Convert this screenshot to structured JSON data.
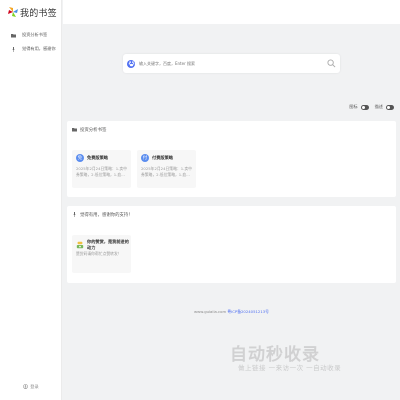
{
  "logo": {
    "text": "我的书签"
  },
  "sidebar": {
    "items": [
      {
        "label": "投资分析书签",
        "icon": "folder-icon"
      },
      {
        "label": "觉得有用，感谢你",
        "icon": "thumbtack-icon"
      }
    ],
    "login_label": "登录"
  },
  "search": {
    "placeholder": "输入关键字，百度，Enter 搜索",
    "engine_label": "百"
  },
  "toggles": {
    "icon_label": "图标",
    "desc_label": "描述"
  },
  "sections": [
    {
      "title": "投资分析书签",
      "sites": [
        {
          "name": "免费版策略",
          "avatar": "免",
          "desc": "2025年2月24日策略：1.卖中券策略，2.低位策略，1.血...",
          "color": "#5b8def"
        },
        {
          "name": "付费版策略",
          "avatar": "付",
          "desc": "2025年2月24日策略：1.卖中券策略，2.低位策略，1.血...",
          "color": "#5b8def"
        }
      ]
    },
    {
      "title": "觉得有用，感谢你的支持！",
      "sites": [
        {
          "name": "你的赞赏，是我前进的动力",
          "avatar": "",
          "desc": "赞赏码请你帮忙点赞转发！",
          "color": "#f0c040"
        }
      ]
    }
  ],
  "footer": {
    "domain": "www.gulaila.com",
    "icp": "粤ICP备2024051213号"
  },
  "watermark": {
    "main": "自动秒收录",
    "sub": "做上链接 一来访一次 一自动收录"
  }
}
